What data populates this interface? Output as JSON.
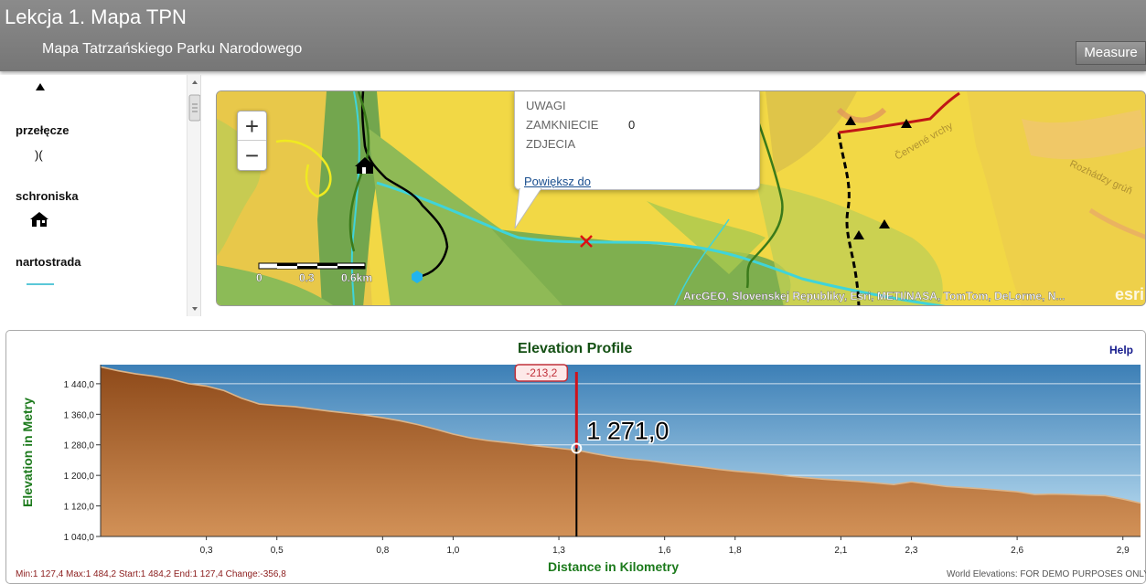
{
  "header": {
    "title": "Lekcja 1. Mapa TPN",
    "subtitle": "Mapa Tatrzańskiego Parku Narodowego",
    "measure_label": "Measure"
  },
  "legend": {
    "items": [
      {
        "label": "",
        "icon": "triangle-icon"
      },
      {
        "label": "przełęcze",
        "icon": "pass-icon",
        "symbol": ")("
      },
      {
        "label": "schroniska",
        "icon": "hut-icon"
      },
      {
        "label": "nartostrada",
        "icon": "ski-line-icon"
      }
    ]
  },
  "map": {
    "zoom_in": "+",
    "zoom_out": "−",
    "scale_labels": [
      "0",
      "0.3",
      "0.6km"
    ],
    "attribution": "ArcGEO, Slovenskej Republiky, Esri, METI/NASA, TomTom, DeLorme, N...",
    "esri_logo": "esri",
    "place_labels": [
      "Červené vrchy",
      "Rozhádzy grúň"
    ],
    "popup": {
      "fields": [
        {
          "name": "UWAGI",
          "value": ""
        },
        {
          "name": "ZAMKNIECIE",
          "value": "0"
        },
        {
          "name": "ZDJECIA",
          "value": ""
        }
      ],
      "link": "Powiększ do"
    }
  },
  "profile": {
    "title": "Elevation Profile",
    "help": "Help",
    "stats": "Min:1 127,4 Max:1 484,2 Start:1 484,2 End:1 127,4 Change:-356,8",
    "credit": "World Elevations: FOR DEMO PURPOSES ONLY"
  },
  "chart_data": {
    "type": "area",
    "title": "Elevation Profile",
    "xlabel": "Distance in Kilometry",
    "ylabel": "Elevation in Metry",
    "xlim": [
      0,
      2.95
    ],
    "ylim": [
      1040,
      1490
    ],
    "x_ticks": [
      0.3,
      0.5,
      0.8,
      1.0,
      1.3,
      1.6,
      1.8,
      2.1,
      2.3,
      2.6,
      2.9
    ],
    "x_tick_labels": [
      "0,3",
      "0,5",
      "0,8",
      "1,0",
      "1,3",
      "1,6",
      "1,8",
      "2,1",
      "2,3",
      "2,6",
      "2,9"
    ],
    "y_ticks": [
      1040,
      1120,
      1200,
      1280,
      1360,
      1440
    ],
    "y_tick_labels": [
      "1 040,0",
      "1 120,0",
      "1 200,0",
      "1 280,0",
      "1 360,0",
      "1 440,0"
    ],
    "x": [
      0,
      0.05,
      0.1,
      0.15,
      0.2,
      0.25,
      0.3,
      0.35,
      0.4,
      0.45,
      0.5,
      0.55,
      0.6,
      0.65,
      0.7,
      0.75,
      0.8,
      0.85,
      0.9,
      0.95,
      1.0,
      1.05,
      1.1,
      1.15,
      1.2,
      1.25,
      1.3,
      1.35,
      1.4,
      1.45,
      1.5,
      1.55,
      1.6,
      1.65,
      1.7,
      1.75,
      1.8,
      1.85,
      1.9,
      1.95,
      2.0,
      2.05,
      2.1,
      2.15,
      2.2,
      2.25,
      2.3,
      2.35,
      2.4,
      2.45,
      2.5,
      2.55,
      2.6,
      2.65,
      2.7,
      2.75,
      2.8,
      2.85,
      2.9,
      2.95
    ],
    "series": [
      {
        "values": [
          1484.2,
          1474,
          1466,
          1460,
          1452,
          1440,
          1434,
          1422,
          1402,
          1387,
          1383,
          1380,
          1374,
          1368,
          1363,
          1358,
          1351,
          1343,
          1333,
          1321,
          1308,
          1298,
          1291,
          1286,
          1281,
          1276,
          1271,
          1266,
          1257,
          1249,
          1243,
          1239,
          1233,
          1227,
          1222,
          1216,
          1211,
          1207,
          1203,
          1198,
          1194,
          1190,
          1187,
          1184,
          1180,
          1176,
          1183,
          1177,
          1171,
          1168,
          1165,
          1161,
          1157,
          1150,
          1151,
          1150,
          1148,
          1147,
          1138,
          1127.4
        ]
      }
    ],
    "marker": {
      "x": 1.35,
      "y": 1271.0,
      "label": "1 271,0",
      "change_label": "-213,2"
    },
    "grid": true,
    "legend": "none"
  }
}
